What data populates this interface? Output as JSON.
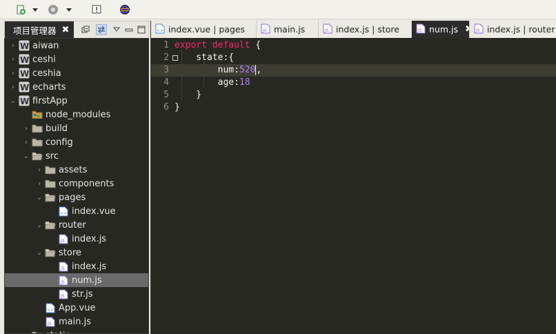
{
  "toolbar": {
    "icons": [
      "new-run-icon",
      "dropdown-arrow-icon",
      "browser-run-icon",
      "dropdown-arrow-icon",
      "terminal-icon",
      "eclipse-icon"
    ]
  },
  "sidebar": {
    "tab_label": "项目管理器",
    "close_glyph": "✖",
    "tree": [
      {
        "label": "aiwan",
        "type": "project",
        "level": 0,
        "arrow": "›"
      },
      {
        "label": "ceshi",
        "type": "project",
        "level": 0,
        "arrow": "›"
      },
      {
        "label": "ceshia",
        "type": "project",
        "level": 0,
        "arrow": "›"
      },
      {
        "label": "echarts",
        "type": "project",
        "level": 0,
        "arrow": "›"
      },
      {
        "label": "firstApp",
        "type": "project",
        "level": 0,
        "arrow": "⌄"
      },
      {
        "label": "node_modules",
        "type": "modules",
        "level": 1,
        "arrow": ""
      },
      {
        "label": "build",
        "type": "folder",
        "level": 1,
        "arrow": "›"
      },
      {
        "label": "config",
        "type": "folder",
        "level": 1,
        "arrow": "›"
      },
      {
        "label": "src",
        "type": "folder-open",
        "level": 1,
        "arrow": "⌄"
      },
      {
        "label": "assets",
        "type": "folder",
        "level": 2,
        "arrow": "›"
      },
      {
        "label": "components",
        "type": "folder",
        "level": 2,
        "arrow": "›"
      },
      {
        "label": "pages",
        "type": "folder-open",
        "level": 2,
        "arrow": "⌄"
      },
      {
        "label": "index.vue",
        "type": "vue",
        "level": 3,
        "arrow": ""
      },
      {
        "label": "router",
        "type": "folder-open",
        "level": 2,
        "arrow": "⌄"
      },
      {
        "label": "index.js",
        "type": "js",
        "level": 3,
        "arrow": ""
      },
      {
        "label": "store",
        "type": "folder-open",
        "level": 2,
        "arrow": "⌄"
      },
      {
        "label": "index.js",
        "type": "js",
        "level": 3,
        "arrow": ""
      },
      {
        "label": "num.js",
        "type": "js",
        "level": 3,
        "arrow": "",
        "selected": true
      },
      {
        "label": "str.js",
        "type": "js",
        "level": 3,
        "arrow": ""
      },
      {
        "label": "App.vue",
        "type": "vue",
        "level": 2,
        "arrow": ""
      },
      {
        "label": "main.js",
        "type": "js",
        "level": 2,
        "arrow": ""
      },
      {
        "label": "static",
        "type": "folder",
        "level": 1,
        "arrow": "›"
      }
    ]
  },
  "editor": {
    "tabs": [
      {
        "label": "index.vue | pages",
        "type": "vue"
      },
      {
        "label": "main.js",
        "type": "js"
      },
      {
        "label": "index.js | store",
        "type": "js"
      },
      {
        "label": "num.js",
        "type": "js",
        "active": true,
        "close": "✖"
      },
      {
        "label": "index.js | router",
        "type": "js"
      }
    ],
    "lines": [
      {
        "n": "1",
        "tokens": [
          {
            "t": "export default",
            "c": "kw"
          },
          {
            "t": " {",
            "c": ""
          }
        ]
      },
      {
        "n": "2",
        "tokens": [
          {
            "t": "    state:{",
            "c": ""
          }
        ]
      },
      {
        "n": "3",
        "tokens": [
          {
            "t": "        num:",
            "c": ""
          },
          {
            "t": "520",
            "c": "num"
          },
          {
            "t": ",",
            "c": ""
          }
        ],
        "current": true
      },
      {
        "n": "4",
        "tokens": [
          {
            "t": "        age:",
            "c": ""
          },
          {
            "t": "18",
            "c": "num"
          }
        ]
      },
      {
        "n": "5",
        "tokens": [
          {
            "t": "    }",
            "c": ""
          }
        ]
      },
      {
        "n": "6",
        "tokens": [
          {
            "t": "}",
            "c": ""
          }
        ]
      }
    ]
  },
  "colors": {
    "editor_bg": "#272822",
    "keyword": "#f92672",
    "number": "#ae81ff",
    "js_icon": "#8a6ec9",
    "vue_icon": "#5a8ad0",
    "folder": "#b9b6a8",
    "project_badge": "#d0d0d0"
  }
}
